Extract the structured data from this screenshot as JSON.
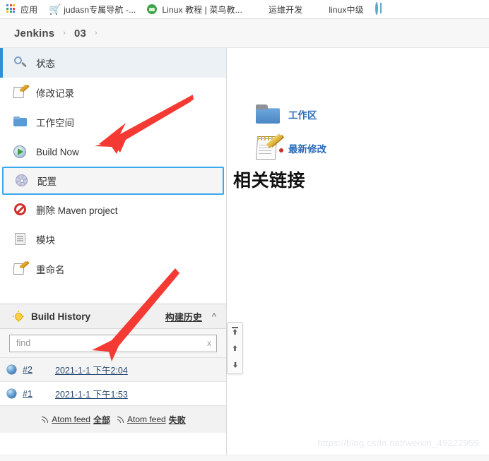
{
  "browser": {
    "bookmarks": [
      {
        "label": "应用",
        "icon": "apps-grid-icon"
      },
      {
        "label": "judasn专属导航 -...",
        "icon": "cart-icon"
      },
      {
        "label": "Linux 教程 | 菜鸟教...",
        "icon": "green-circle-icon"
      },
      {
        "label": "运维开发",
        "icon": "tux-icon"
      },
      {
        "label": "linux中级",
        "icon": "tux-icon"
      },
      {
        "label": "",
        "icon": "globe-icon"
      }
    ]
  },
  "breadcrumb": {
    "items": [
      "Jenkins",
      "03"
    ],
    "separator": "›"
  },
  "sidebar": {
    "tasks": [
      {
        "label": "状态",
        "icon": "search-icon",
        "state": "selected"
      },
      {
        "label": "修改记录",
        "icon": "note-pencil-icon",
        "state": "normal"
      },
      {
        "label": "工作空间",
        "icon": "folder-icon",
        "state": "normal"
      },
      {
        "label": "Build Now",
        "icon": "build-play-icon",
        "state": "normal"
      },
      {
        "label": "配置",
        "icon": "gear-icon",
        "state": "focused"
      },
      {
        "label": "删除 Maven project",
        "icon": "delete-deny-icon",
        "state": "normal"
      },
      {
        "label": "模块",
        "icon": "module-icon",
        "state": "normal"
      },
      {
        "label": "重命名",
        "icon": "rename-pencil-icon",
        "state": "normal"
      }
    ],
    "build_history": {
      "title": "Build History",
      "title_icon": "sun-icon",
      "zh_link": "构建历史",
      "collapse_icon": "chevron-up-icon",
      "find": {
        "placeholder": "find",
        "value": "",
        "clear_label": "x"
      },
      "builds": [
        {
          "status_icon": "blue-ball-icon",
          "number": "#2",
          "date": "2021-1-1 下午2:04"
        },
        {
          "status_icon": "blue-ball-icon",
          "number": "#1",
          "date": "2021-1-1 下午1:53"
        }
      ],
      "atom_feeds": [
        {
          "icon": "rss-icon",
          "prefix": "Atom feed ",
          "suffix": "全部"
        },
        {
          "icon": "rss-icon",
          "prefix": "Atom feed ",
          "suffix": "失败"
        }
      ]
    },
    "scroll_controls": [
      {
        "name": "scroll-to-top-button",
        "icon": "arrow-to-top-icon"
      },
      {
        "name": "scroll-up-button",
        "icon": "arrow-up-icon"
      },
      {
        "name": "scroll-down-button",
        "icon": "arrow-down-icon"
      }
    ]
  },
  "main": {
    "links": [
      {
        "label": "工作区",
        "icon": "folder-large-icon"
      },
      {
        "label": "最新修改",
        "icon": "notepad-pencil-large-icon"
      }
    ],
    "section_title": "相关链接"
  },
  "annotations": {
    "arrow_color": "#F43A32",
    "arrows": [
      {
        "name": "arrow-pointing-to-build-now",
        "from": "upper-right",
        "to": "build-now-row"
      },
      {
        "name": "arrow-pointing-to-find-box",
        "from": "upper-right",
        "to": "build-find-box"
      }
    ]
  },
  "watermark": {
    "text": "https://blog.csdn.net/weixin_49222959"
  }
}
